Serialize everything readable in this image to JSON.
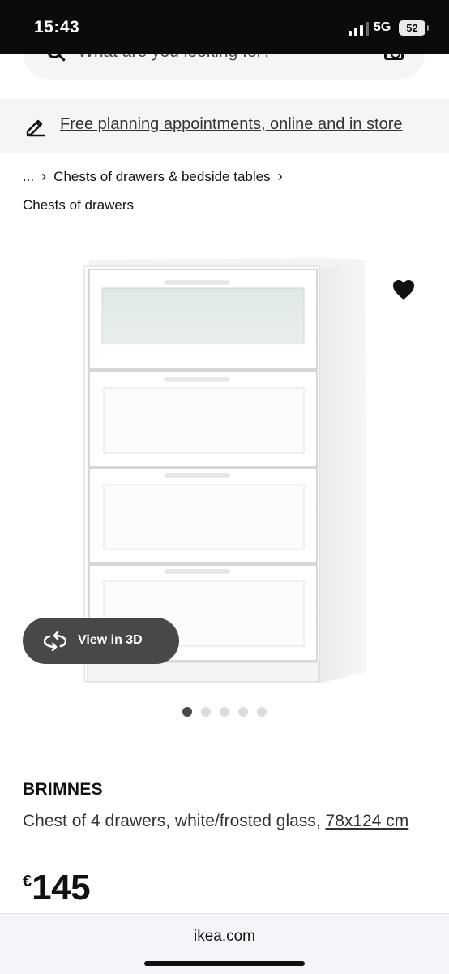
{
  "status_bar": {
    "time": "15:43",
    "network": "5G",
    "battery": "52"
  },
  "search": {
    "placeholder": "What are you looking for?"
  },
  "banner": {
    "text": "Free planning appointments, online and in store"
  },
  "breadcrumb": {
    "ellipsis": "...",
    "items": [
      "Chests of drawers & bedside tables"
    ],
    "current": "Chests of drawers"
  },
  "gallery": {
    "view_3d_label": "View in 3D",
    "image_count": 5,
    "active_index": 0,
    "favorite": true
  },
  "product": {
    "name": "BRIMNES",
    "description": "Chest of 4 drawers, white/frosted glass,",
    "size_link": "78x124 cm",
    "currency": "€",
    "price": "145"
  },
  "browser": {
    "domain": "ikea.com"
  },
  "icons": [
    "signal-icon",
    "search-icon",
    "camera-icon",
    "pencil-icon",
    "chevron-right-icon",
    "heart-icon",
    "rotate-3d-icon"
  ]
}
